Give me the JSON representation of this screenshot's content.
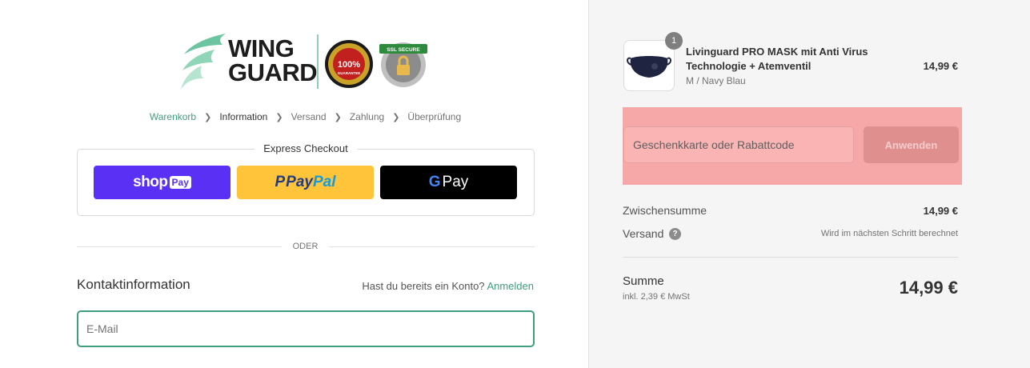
{
  "logo": {
    "line1": "WING",
    "line2": "GUARD",
    "badge_guarantee_text": "100%",
    "badge_guarantee_sub": "GUARANTEE",
    "badge_ssl_text": "SSL SECURE"
  },
  "breadcrumb": {
    "items": [
      "Warenkorb",
      "Information",
      "Versand",
      "Zahlung",
      "Überprüfung"
    ]
  },
  "express": {
    "title": "Express Checkout",
    "shop_word": "shop",
    "shop_pay": "Pay",
    "paypal_p": "P",
    "paypal_pay": "Pay",
    "paypal_pal": "Pal",
    "gpay_g": "G",
    "gpay_text": "Pay"
  },
  "divider": {
    "label": "ODER"
  },
  "contact": {
    "title": "Kontaktinformation",
    "login_hint": "Hast du bereits ein Konto?",
    "login_link": "Anmelden",
    "email_placeholder": "E-Mail"
  },
  "order": {
    "quantity": "1",
    "product_name": "Livinguard PRO MASK mit Anti Virus Technologie + Atemventil",
    "product_variant": "M / Navy Blau",
    "product_price": "14,99 €",
    "discount_placeholder": "Geschenkkarte oder Rabattcode",
    "apply_label": "Anwenden",
    "subtotal_label": "Zwischensumme",
    "subtotal_value": "14,99 €",
    "shipping_label": "Versand",
    "shipping_help": "?",
    "shipping_value": "Wird im nächsten Schritt berechnet",
    "total_label": "Summe",
    "tax_note": "inkl. 2,39 € MwSt",
    "total_value": "14,99 €"
  },
  "colors": {
    "accent": "#3f9e7b",
    "shop_pay": "#5a31f4",
    "paypal": "#ffc439",
    "discount_highlight": "#f6a8a8"
  }
}
